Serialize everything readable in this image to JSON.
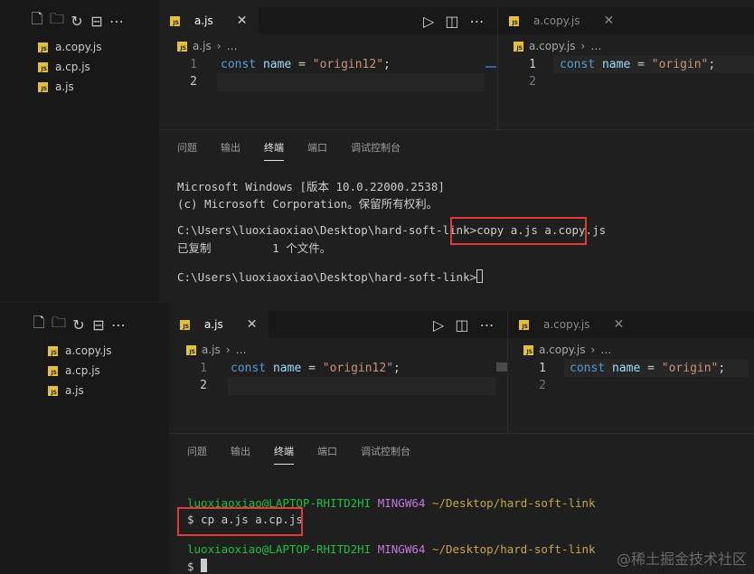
{
  "sidebar_tools": [
    "new-file-icon",
    "new-folder-icon",
    "refresh-icon",
    "collapse-icon",
    "more-icon"
  ],
  "files": [
    "a.copy.js",
    "a.cp.js",
    "a.js"
  ],
  "editor_left": {
    "tab_label": "a.js",
    "breadcrumb_file": "a.js",
    "breadcrumb_rest": "…",
    "line1_num": "1",
    "line2_num": "2",
    "kw": "const",
    "var": "name",
    "eq": " = ",
    "str": "\"origin12\"",
    "semi": ";"
  },
  "editor_right": {
    "tab_label": "a.copy.js",
    "breadcrumb_file": "a.copy.js",
    "breadcrumb_rest": "…",
    "line1_num": "1",
    "line2_num": "2",
    "kw": "const",
    "var": "name",
    "eq": " = ",
    "str": "\"origin\"",
    "semi": ";"
  },
  "panel_tabs": [
    "问题",
    "输出",
    "终端",
    "端口",
    "调试控制台"
  ],
  "terminal1": {
    "line1": "Microsoft Windows [版本 10.0.22000.2538]",
    "line2": "(c) Microsoft Corporation。保留所有权利。",
    "prompt": "C:\\Users\\luoxiaoxiao\\Desktop\\hard-soft-link>",
    "command": "copy a.js a.copy.js",
    "result": "已复制         1 个文件。",
    "prompt2": "C:\\Users\\luoxiaoxiao\\Desktop\\hard-soft-link>"
  },
  "terminal2": {
    "user": "luoxiaoxiao@LAPTOP-RHITD2HI",
    "env": "MINGW64",
    "path": "~/Desktop/hard-soft-link",
    "command": "$ cp a.js a.cp.js",
    "user2": "luoxiaoxiao@LAPTOP-RHITD2HI",
    "env2": "MINGW64",
    "path2": "~/Desktop/hard-soft-link",
    "prompt": "$ "
  },
  "watermark": "@稀土掘金技术社区",
  "colors": {
    "highlight": "#e53935",
    "js_icon": "#e5c03b"
  }
}
